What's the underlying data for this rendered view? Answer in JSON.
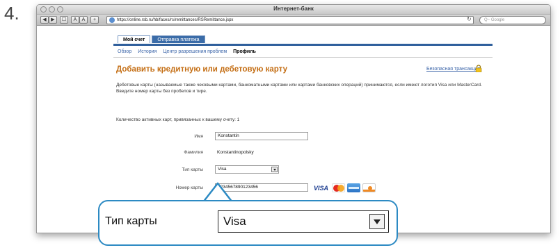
{
  "step": {
    "number": "4."
  },
  "browser": {
    "window_title": "Интернет-банк",
    "url": "https://online.rsb.ru/hb/faces/rs/remittances/RSRemittance.jspx",
    "search_placeholder": "Q~ Google",
    "nav_buttons": [
      "◀",
      "▶",
      "☐",
      "A",
      "A",
      "+"
    ]
  },
  "tabs": [
    {
      "label": "Мой счет",
      "active": true
    },
    {
      "label": "Отправка платежа",
      "active": false
    }
  ],
  "subnav": [
    {
      "label": "Обзор",
      "current": false
    },
    {
      "label": "История",
      "current": false
    },
    {
      "label": "Центр разрешения проблем",
      "current": false
    },
    {
      "label": "Профиль",
      "current": true
    }
  ],
  "page": {
    "title": "Добавить кредитную или дебетовую карту",
    "secure_link": "Безопасная трансакция",
    "secure_icon": "padlock-icon",
    "description": "Дебетовые карты (называемые также чековыми картами, банкоматными картами или картами банковских операций) принимаются, если имеют логотип Visa или MasterCard. Введите номер карты без пробелов и тире.",
    "active_cards_text": "Количество активных карт, привязанных к вашему счету: 1"
  },
  "form": {
    "first_name": {
      "label": "Имя",
      "value": "Konstantin"
    },
    "last_name": {
      "label": "Фамилия",
      "value": "Konstantinopolsky"
    },
    "card_type": {
      "label": "Тип карты",
      "value": "Visa"
    },
    "card_number": {
      "label": "Номер карты",
      "value": "1234567890123456"
    }
  },
  "card_logos": {
    "visa": "VISA",
    "others": [
      "mastercard-icon",
      "amex-icon",
      "discover-icon"
    ]
  },
  "callout": {
    "label": "Тип карты",
    "value": "Visa"
  },
  "colors": {
    "title_orange": "#c46e14",
    "tab_blue": "#2f5f9c",
    "link_blue": "#3a64a8",
    "callout_blue": "#2c8ac3"
  }
}
